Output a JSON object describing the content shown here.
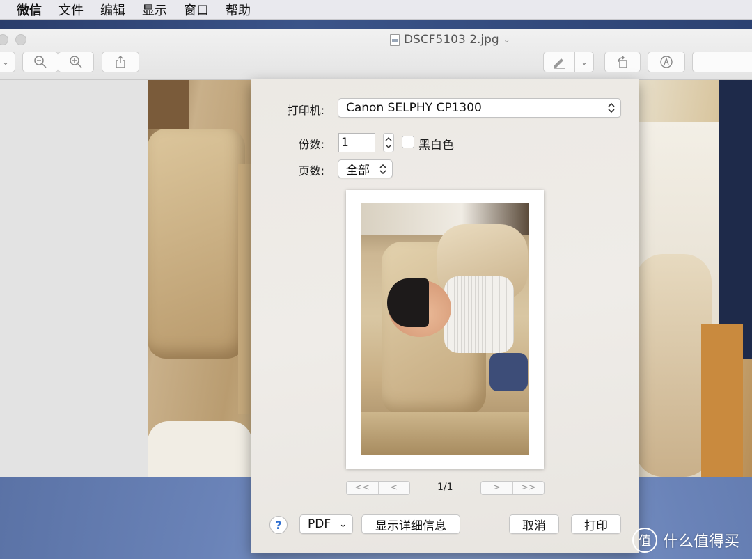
{
  "menubar": {
    "app": "微信",
    "items": [
      "文件",
      "编辑",
      "显示",
      "窗口",
      "帮助"
    ]
  },
  "window": {
    "title": "DSCF5103 2.jpg"
  },
  "print_dialog": {
    "printer_label": "打印机:",
    "printer_value": "Canon SELPHY CP1300",
    "copies_label": "份数:",
    "copies_value": "1",
    "bw_label": "黑白色",
    "bw_checked": false,
    "pages_label": "页数:",
    "pages_value": "全部",
    "page_indicator": "1/1",
    "nav_first": "<<",
    "nav_prev": "<",
    "nav_next": ">",
    "nav_last": ">>",
    "help": "?",
    "pdf_label": "PDF",
    "show_details": "显示详细信息",
    "cancel": "取消",
    "print": "打印"
  },
  "watermark": {
    "badge": "值",
    "text": "什么值得买"
  }
}
